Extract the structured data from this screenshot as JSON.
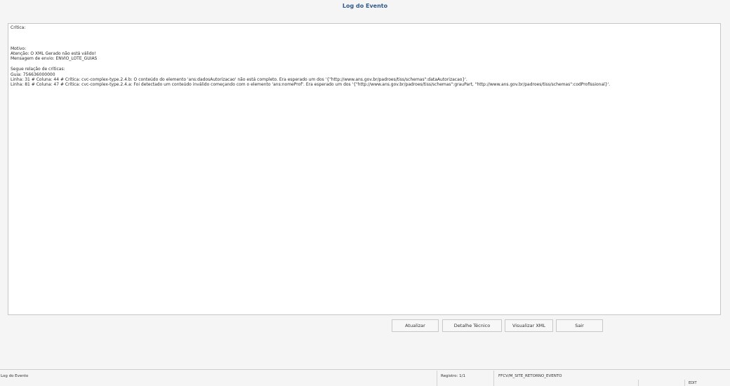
{
  "window": {
    "title": "Log do Evento"
  },
  "log": {
    "lines": [
      "Crítica:",
      "",
      "",
      "",
      "Motivo:",
      "Atenção: O XML Gerado não está válido!",
      "Mensagem de envio: ENVIO_LOTE_GUIAS",
      "",
      "Segue relação de críticas:",
      "Guia: 756636000000",
      "Linha: 31 # Coluna: 44 # Crítica: cvc-complex-type.2.4.b: O conteúdo do elemento 'ans:dadosAutorizacao' não está completo. Era esperado um dos '{\"http://www.ans.gov.br/padroes/tiss/schemas\":dataAutorizacao}'.",
      "Linha: 81 # Coluna: 47 # Crítica: cvc-complex-type.2.4.a: Foi detectado um conteúdo inválido começando com o elemento 'ans:nomeProf'. Era esperado um dos '{\"http://www.ans.gov.br/padroes/tiss/schemas\":grauPart, \"http://www.ans.gov.br/padroes/tiss/schemas\":codProfissional}'."
    ]
  },
  "buttons": {
    "atualizar": "Atualizar",
    "detalhe_tecnico": "Detalhe Técnico",
    "visualizar_xml": "Visualizar XML",
    "sair": "Sair"
  },
  "status": {
    "screen": "Log do Evento",
    "registro": "Registro: 1/1",
    "program": "FFCV/M_SITE_RETORNO_EVENTO",
    "mode": "EDIT"
  }
}
